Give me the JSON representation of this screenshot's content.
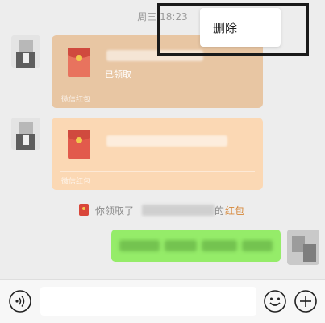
{
  "chat": {
    "timestamp": "周三 18:23"
  },
  "context_menu": {
    "delete_label": "删除"
  },
  "messages": {
    "red_packet_1": {
      "status": "已领取",
      "footer": "微信红包"
    },
    "red_packet_2": {
      "footer": "微信红包"
    },
    "system_notice": {
      "prefix": "你领取了",
      "suffix": "的",
      "link": "红包"
    }
  },
  "icons": {
    "voice": "voice-icon",
    "emoji": "emoji-icon",
    "more": "plus-icon"
  },
  "colors": {
    "background": "#ededed",
    "red_packet_opened": "#e8c6a3",
    "red_packet_new": "#fbd8b4",
    "sent_bubble": "#95ec69",
    "red_packet_link": "#d6883a"
  }
}
